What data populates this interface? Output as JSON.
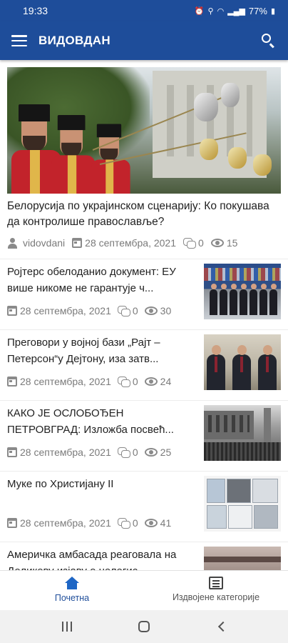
{
  "status_bar": {
    "time": "19:33",
    "icons": [
      "alarm-icon",
      "location-icon",
      "wifi-icon",
      "signal-icon",
      "battery-icon"
    ],
    "battery": "77%"
  },
  "app_bar": {
    "title": "ВИДОВДАН",
    "color": "#1e4d9a"
  },
  "featured": {
    "title": "Белорусија по украјинском сценарију: Ко покушава да контролише православље?",
    "author": "vidovdani",
    "date": "28 септембра, 2021",
    "comments": "0",
    "views": "15"
  },
  "articles": [
    {
      "title": "Ројтерс обелоданио документ: ЕУ више никоме не гарантује ч...",
      "date": "28 септембра, 2021",
      "comments": "0",
      "views": "30"
    },
    {
      "title": "Преговори у војној бази „Рајт –Петерсон“у Дејтону, иза затв...",
      "date": "28 септембра, 2021",
      "comments": "0",
      "views": "24"
    },
    {
      "title": "КАКО ЈЕ ОСЛОБОЂЕН ПЕТРОВГРАД: Изложба посвећ...",
      "date": "28 септембра, 2021",
      "comments": "0",
      "views": "25"
    },
    {
      "title": "Муке по Христијану II",
      "date": "28 септембра, 2021",
      "comments": "0",
      "views": "41"
    },
    {
      "title": "Америчка амбасада реаговала на Доликову изјаву о нелегис...",
      "date": "",
      "comments": "",
      "views": ""
    }
  ],
  "bottom_nav": {
    "home_label": "Почетна",
    "categories_label": "Издвојене категорије",
    "active_color": "#1e66c5"
  }
}
